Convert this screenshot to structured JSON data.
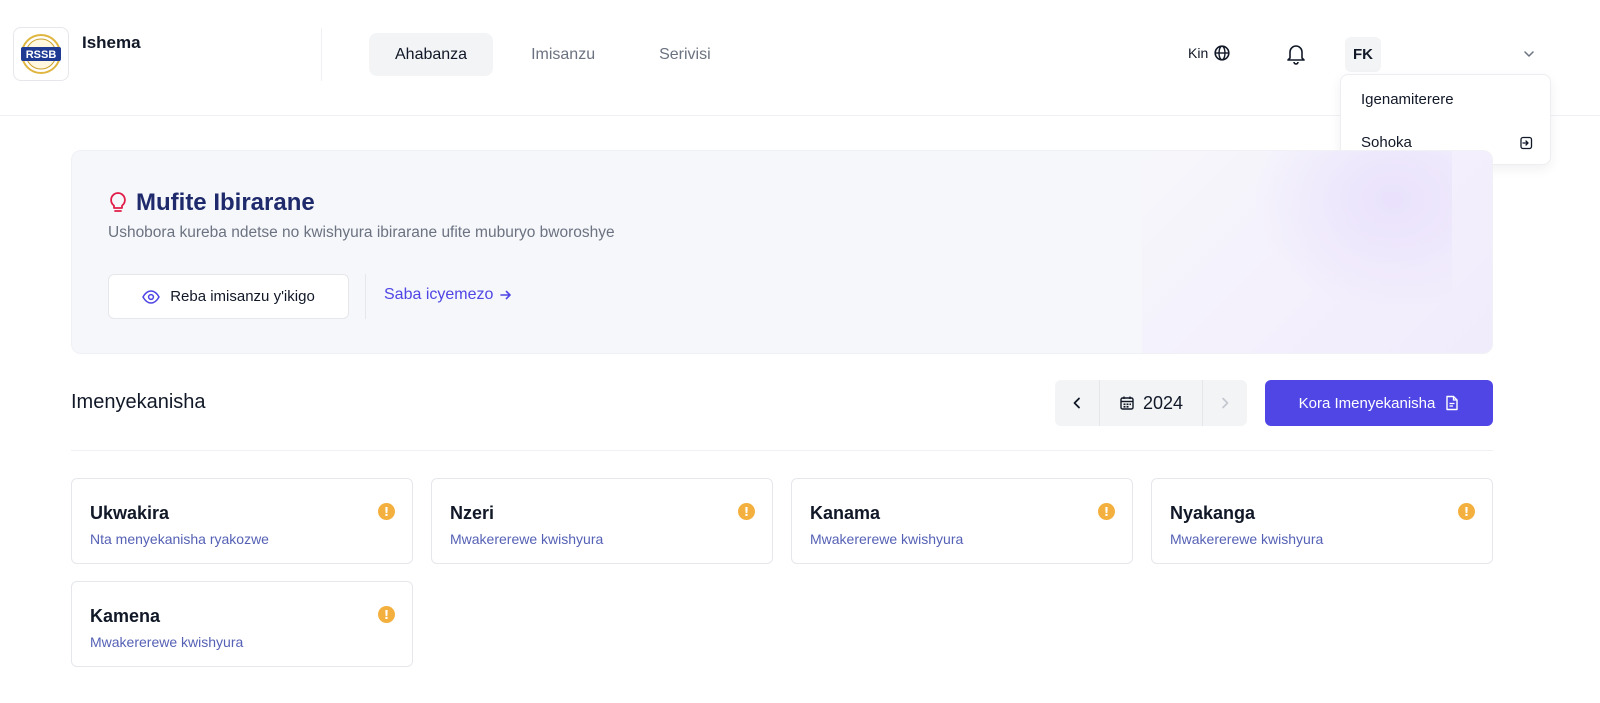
{
  "header": {
    "brand": "Ishema",
    "nav": [
      {
        "label": "Ahabanza",
        "active": true
      },
      {
        "label": "Imisanzu",
        "active": false
      },
      {
        "label": "Serivisi",
        "active": false
      }
    ],
    "language": "Kin",
    "avatar_initials": "FK",
    "icons": {
      "language": "globe-icon",
      "notifications": "bell-icon",
      "menu": "chevron-down-icon"
    }
  },
  "user_menu": {
    "items": [
      {
        "label": "Igenamiterere"
      },
      {
        "label": "Sohoka",
        "icon": "logout-icon"
      }
    ]
  },
  "banner": {
    "title": "Mufite Ibirarane",
    "subtitle": "Ushobora kureba ndetse no kwishyura ibirarane ufite muburyo bworoshye",
    "view_button": "Reba imisanzu y'ikigo",
    "link": "Saba icyemezo",
    "title_icon": "lightbulb-icon"
  },
  "declarations": {
    "title": "Imenyekanisha",
    "year": "2024",
    "create_button": "Kora Imenyekanisha",
    "cards": [
      {
        "month": "Ukwakira",
        "status": "Nta menyekanisha ryakozwe"
      },
      {
        "month": "Nzeri",
        "status": "Mwakererewe kwishyura"
      },
      {
        "month": "Kanama",
        "status": "Mwakererewe kwishyura"
      },
      {
        "month": "Nyakanga",
        "status": "Mwakererewe kwishyura"
      },
      {
        "month": "Kamena",
        "status": "Mwakererewe kwishyura"
      }
    ]
  },
  "colors": {
    "primary": "#4f46e5",
    "warning": "#f4b03e",
    "title_navy": "#1e2a6b",
    "icon_red": "#e11d48"
  }
}
